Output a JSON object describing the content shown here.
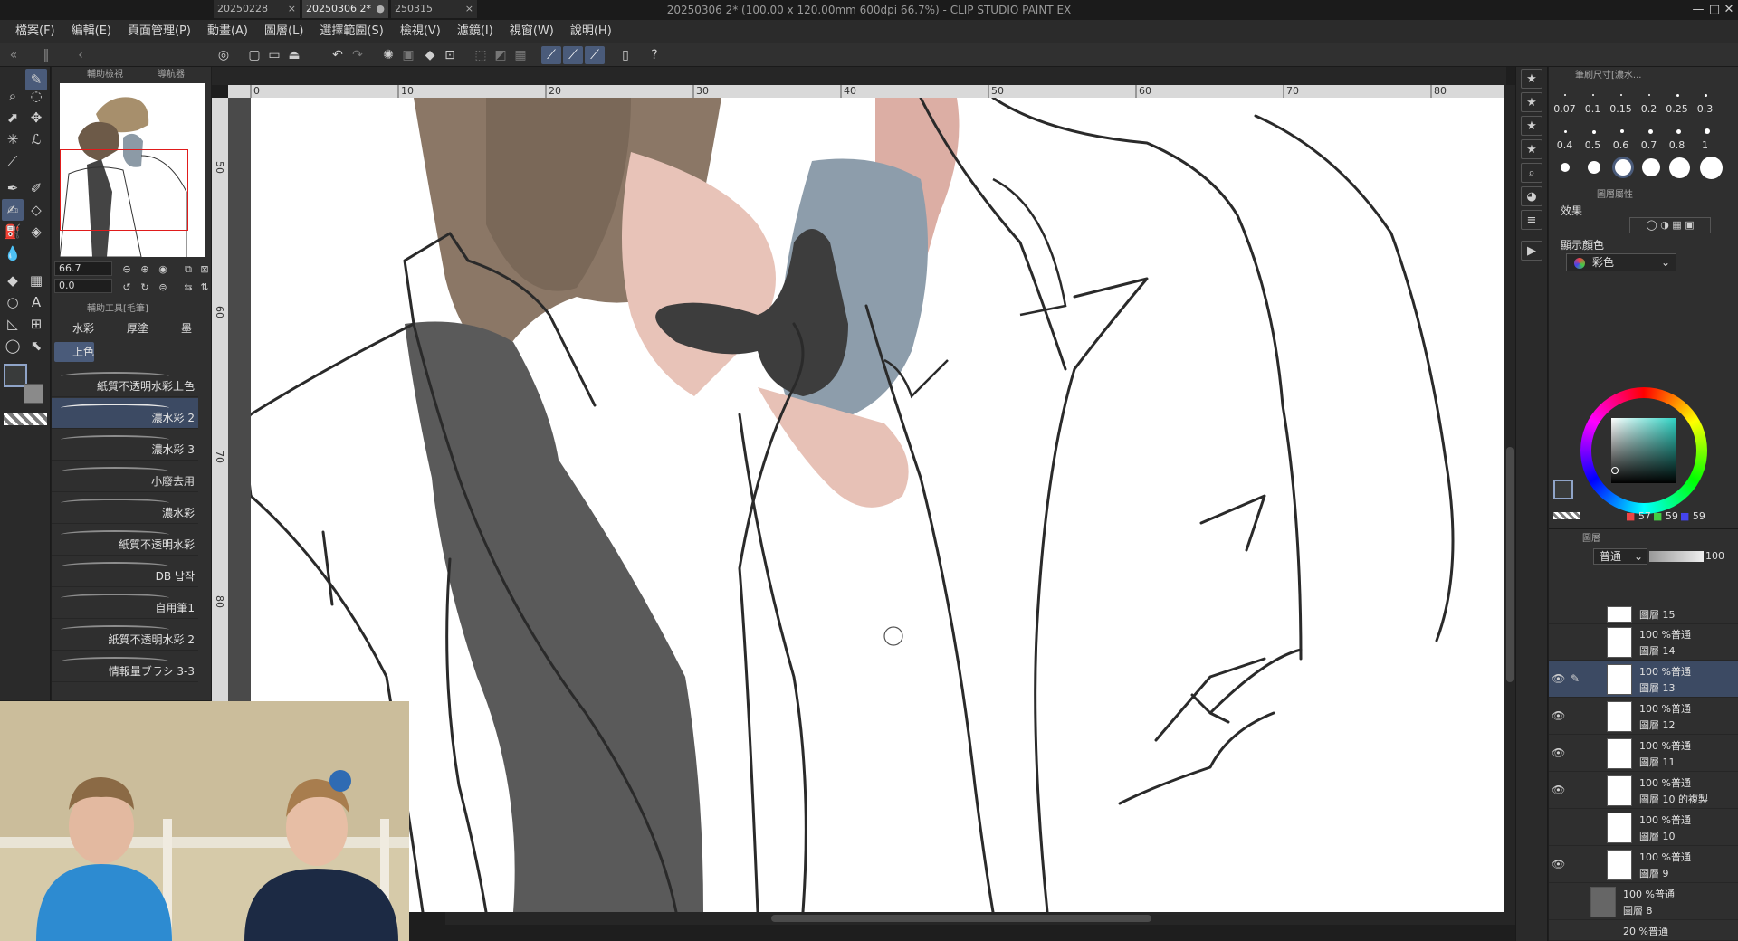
{
  "window": {
    "title": "20250306 2* (100.00 x 120.00mm 600dpi 66.7%) - CLIP STUDIO PAINT EX",
    "controls": [
      "—",
      "□",
      "✕"
    ]
  },
  "menu": [
    "檔案(F)",
    "編輯(E)",
    "頁面管理(P)",
    "動畫(A)",
    "圖層(L)",
    "選擇範圍(S)",
    "檢視(V)",
    "濾鏡(I)",
    "視窗(W)",
    "說明(H)"
  ],
  "doc_tabs": [
    {
      "label": "20250228",
      "close": "×"
    },
    {
      "label": "20250306 2*",
      "close": "●"
    },
    {
      "label": "250315",
      "close": "×"
    }
  ],
  "navigator": {
    "tabs": [
      "輔助檢視",
      "導航器"
    ],
    "zoom": "66.7",
    "rotation": "0.0"
  },
  "subtool": {
    "header": "輔助工具[毛筆]",
    "groups": [
      "水彩",
      "厚塗",
      "墨"
    ],
    "active_group": "上色",
    "brushes": [
      "紙質不透明水彩上色",
      "濃水彩 2",
      "濃水彩 3",
      "小廢去用",
      "濃水彩",
      "紙質不透明水彩",
      "DB 납작",
      "自用筆1",
      "紙質不透明水彩 2",
      "情報量ブラシ 3-3"
    ]
  },
  "ruler": {
    "h": [
      "0",
      "10",
      "20",
      "30",
      "40",
      "50",
      "60",
      "70",
      "80"
    ],
    "v": [
      "50",
      "60",
      "70",
      "80"
    ]
  },
  "brush_size": {
    "header": "筆刷尺寸[濃水...",
    "sizes_row1": [
      "0.07",
      "0.1",
      "0.15",
      "0.2",
      "0.25",
      "0.3"
    ],
    "sizes_row2": [
      "0.4",
      "0.5",
      "0.6",
      "0.7",
      "0.8",
      "1"
    ]
  },
  "layer_property": {
    "header": "圖層屬性",
    "effect_label": "效果",
    "display_color_label": "顯示顏色",
    "display_color_value": "彩色"
  },
  "color": {
    "r": "57",
    "g": "59",
    "b": "59",
    "hex": "#393b3b"
  },
  "layers_panel": {
    "tab": "圖層",
    "blend_mode": "普通",
    "opacity": "100"
  },
  "layers": [
    {
      "opacity_mode": "",
      "name": "圖層 15",
      "visible": false
    },
    {
      "opacity_mode": "100 %普通",
      "name": "圖層 14",
      "visible": false
    },
    {
      "opacity_mode": "100 %普通",
      "name": "圖層 13",
      "visible": true,
      "selected": true
    },
    {
      "opacity_mode": "100 %普通",
      "name": "圖層 12",
      "visible": true
    },
    {
      "opacity_mode": "100 %普通",
      "name": "圖層 11",
      "visible": true
    },
    {
      "opacity_mode": "100 %普通",
      "name": "圖層 10 的複製",
      "visible": true
    },
    {
      "opacity_mode": "100 %普通",
      "name": "圖層 10",
      "visible": false
    },
    {
      "opacity_mode": "100 %普通",
      "name": "圖層 9",
      "visible": true
    },
    {
      "opacity_mode": "100 %普通",
      "name": "圖層 8",
      "visible": false
    },
    {
      "opacity_mode": "20 %普通",
      "name": "",
      "visible": false
    }
  ]
}
